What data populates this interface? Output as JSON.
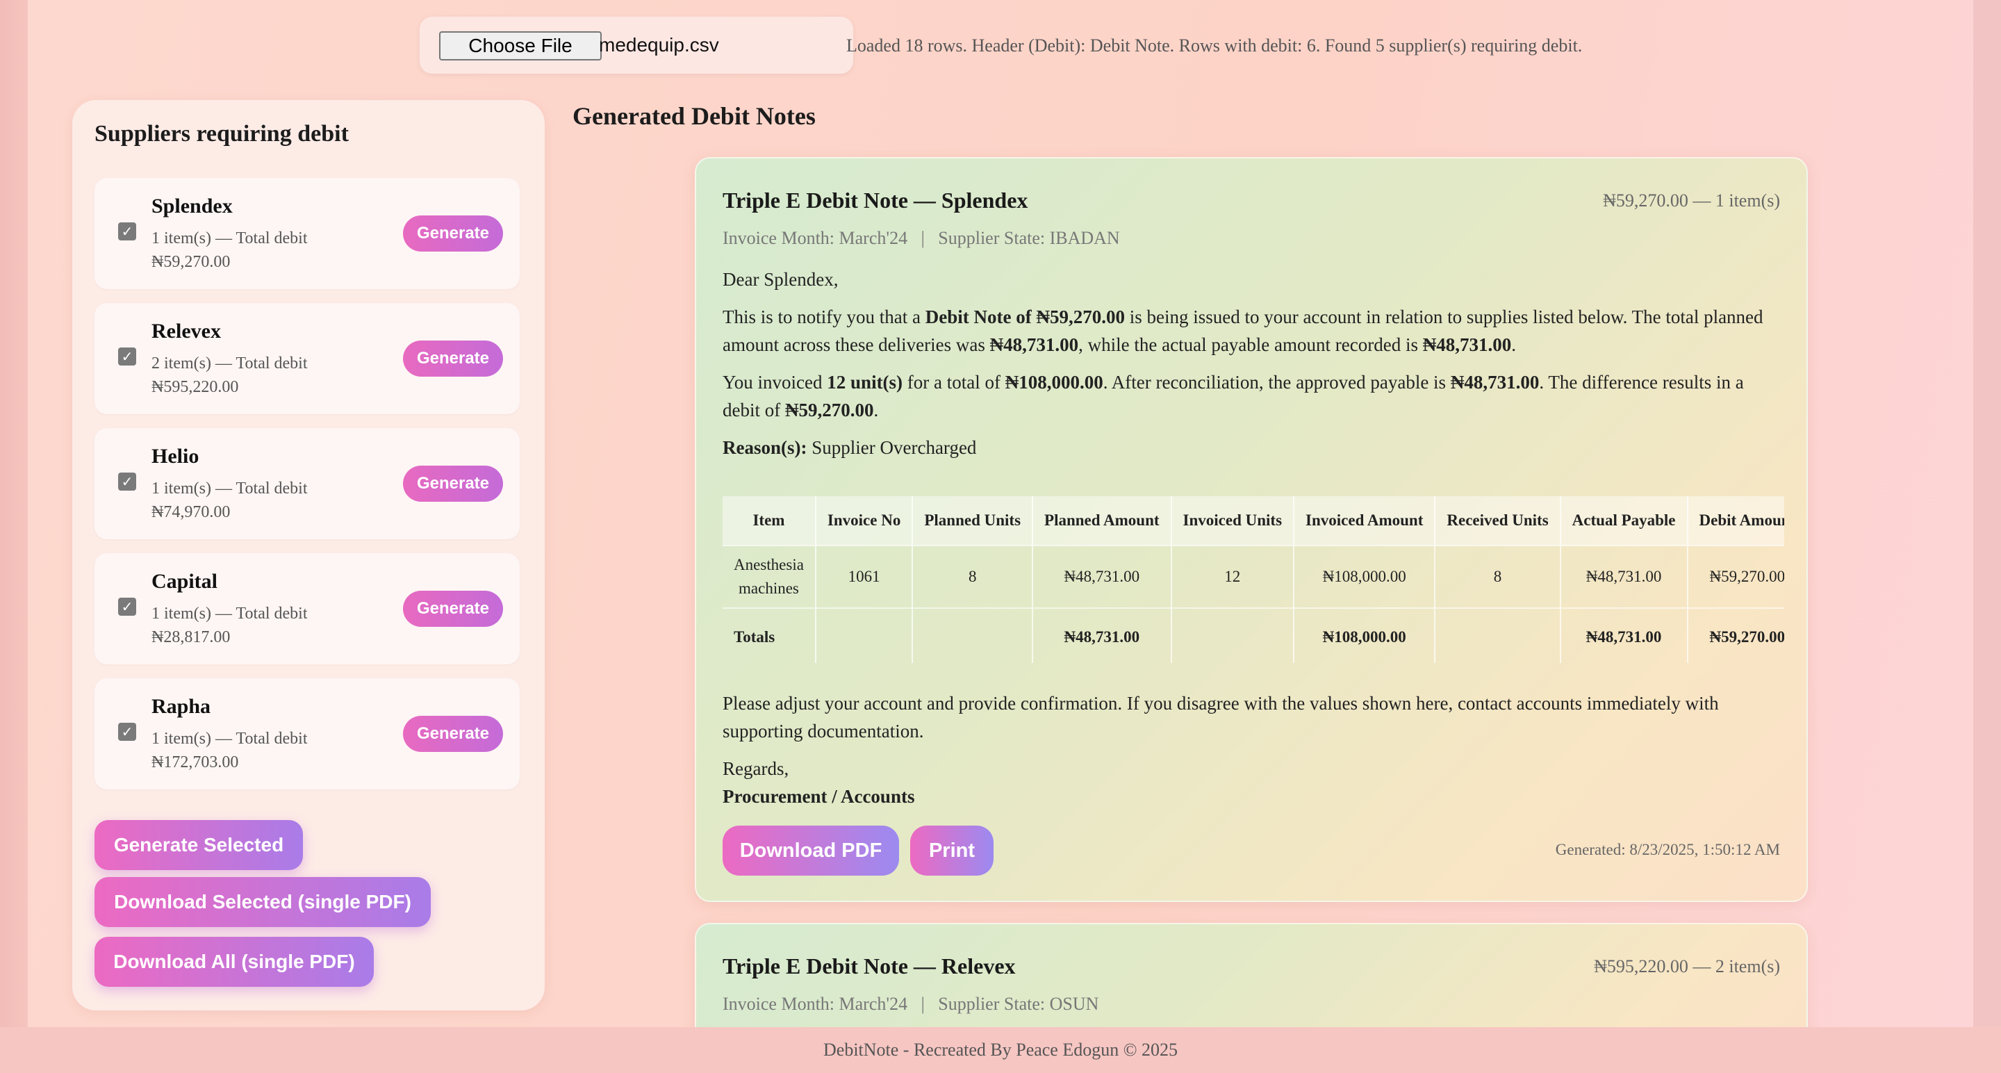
{
  "file": {
    "button_label": "Choose File",
    "file_name": "medequip.csv"
  },
  "status": "Loaded 18 rows. Header (Debit): Debit Note. Rows with debit: 6. Found 5 supplier(s) requiring debit.",
  "sidebar": {
    "title": "Suppliers requiring debit",
    "suppliers": [
      {
        "name": "Splendex",
        "meta": "1 item(s) — Total debit ₦59,270.00",
        "checked": true,
        "button": "Generate"
      },
      {
        "name": "Relevex",
        "meta": "2 item(s) — Total debit ₦595,220.00",
        "checked": true,
        "button": "Generate"
      },
      {
        "name": "Helio",
        "meta": "1 item(s) — Total debit ₦74,970.00",
        "checked": true,
        "button": "Generate"
      },
      {
        "name": "Capital",
        "meta": "1 item(s) — Total debit ₦28,817.00",
        "checked": true,
        "button": "Generate"
      },
      {
        "name": "Rapha",
        "meta": "1 item(s) — Total debit ₦172,703.00",
        "checked": true,
        "button": "Generate"
      }
    ],
    "actions": {
      "generate_selected": "Generate Selected",
      "download_selected": "Download Selected (single PDF)",
      "download_all": "Download All (single PDF)"
    }
  },
  "main": {
    "title": "Generated Debit Notes",
    "notes": [
      {
        "title": "Triple E Debit Note — Splendex",
        "summary": "₦59,270.00 — 1 item(s)",
        "subline": "Invoice Month: March'24   |   Supplier State: IBADAN",
        "greeting": "Dear Splendex,",
        "para1": {
          "a": "This is to notify you that a ",
          "b": "Debit Note of ₦59,270.00",
          "c": " is being issued to your account in relation to supplies listed below. The total planned amount across these deliveries was ",
          "d": "₦48,731.00",
          "e": ", while the actual payable amount recorded is ",
          "f": "₦48,731.00",
          "g": "."
        },
        "para2": {
          "a": "You invoiced ",
          "b": "12 unit(s)",
          "c": " for a total of ",
          "d": "₦108,000.00",
          "e": ". After reconciliation, the approved payable is ",
          "f": "₦48,731.00",
          "g": ". The difference results in a debit of ",
          "h": "₦59,270.00",
          "i": "."
        },
        "reason_label": "Reason(s):",
        "reason": " Supplier Overcharged",
        "table": {
          "headers": [
            "Item",
            "Invoice No",
            "Planned Units",
            "Planned Amount",
            "Invoiced Units",
            "Invoiced Amount",
            "Received Units",
            "Actual Payable",
            "Debit Amount"
          ],
          "row": [
            "Anesthesia machines",
            "1061",
            "8",
            "₦48,731.00",
            "12",
            "₦108,000.00",
            "8",
            "₦48,731.00",
            "₦59,270.00"
          ],
          "totals": [
            "Totals",
            "",
            "",
            "₦48,731.00",
            "",
            "₦108,000.00",
            "",
            "₦48,731.00",
            "₦59,270.00"
          ]
        },
        "closing": "Please adjust your account and provide confirmation. If you disagree with the values shown here, contact accounts immediately with supporting documentation.",
        "regards": "Regards,",
        "signoff": "Procurement / Accounts",
        "download_label": "Download PDF",
        "print_label": "Print",
        "generated": "Generated: 8/23/2025, 1:50:12 AM"
      },
      {
        "title": "Triple E Debit Note — Relevex",
        "summary": "₦595,220.00 — 2 item(s)",
        "subline": "Invoice Month: March'24   |   Supplier State: OSUN"
      }
    ]
  },
  "footer": "DebitNote - Recreated By Peace Edogun © 2025"
}
